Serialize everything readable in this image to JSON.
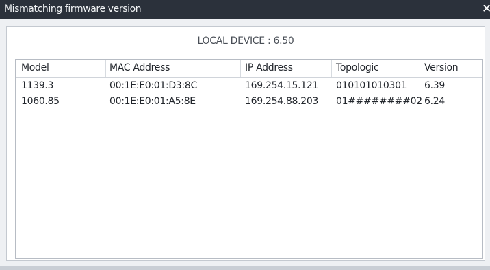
{
  "window": {
    "title": "Mismatching firmware version",
    "close_glyph": "✕"
  },
  "local_device_label": "LOCAL DEVICE : 6.50",
  "table": {
    "columns": [
      "Model",
      "MAC Address",
      "IP Address",
      "Topologic",
      "Version"
    ],
    "rows": [
      {
        "model": "1139.3",
        "mac": "00:1E:E0:01:D3:8C",
        "ip": "169.254.15.121",
        "topologic": "010101010301",
        "version": "6.39"
      },
      {
        "model": "1060.85",
        "mac": "00:1E:E0:01:A5:8E",
        "ip": "169.254.88.203",
        "topologic": "01########02",
        "version": "6.24"
      }
    ]
  },
  "colors": {
    "titlebar": "#2b313b",
    "background": "#eef0f3",
    "panel": "#ffffff",
    "text": "#22262c"
  }
}
